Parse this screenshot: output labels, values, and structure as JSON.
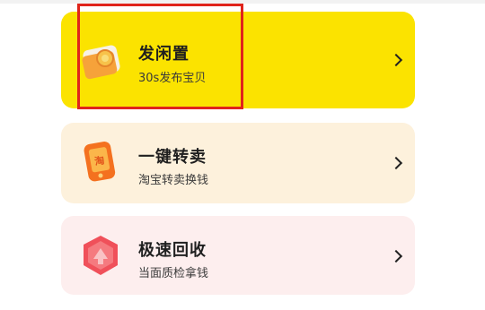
{
  "colors": {
    "card1_bg": "#fbe300",
    "card2_bg": "#fdf1dc",
    "card3_bg": "#fdeeee",
    "highlight": "#e0241b"
  },
  "cards": [
    {
      "title": "发闲置",
      "subtitle": "30s发布宝贝",
      "icon": "camera-tag-icon"
    },
    {
      "title": "一键转卖",
      "subtitle": "淘宝转卖换钱",
      "icon": "taobao-phone-icon"
    },
    {
      "title": "极速回收",
      "subtitle": "当面质检拿钱",
      "icon": "recycle-badge-icon"
    }
  ],
  "taobao_char": "淘"
}
